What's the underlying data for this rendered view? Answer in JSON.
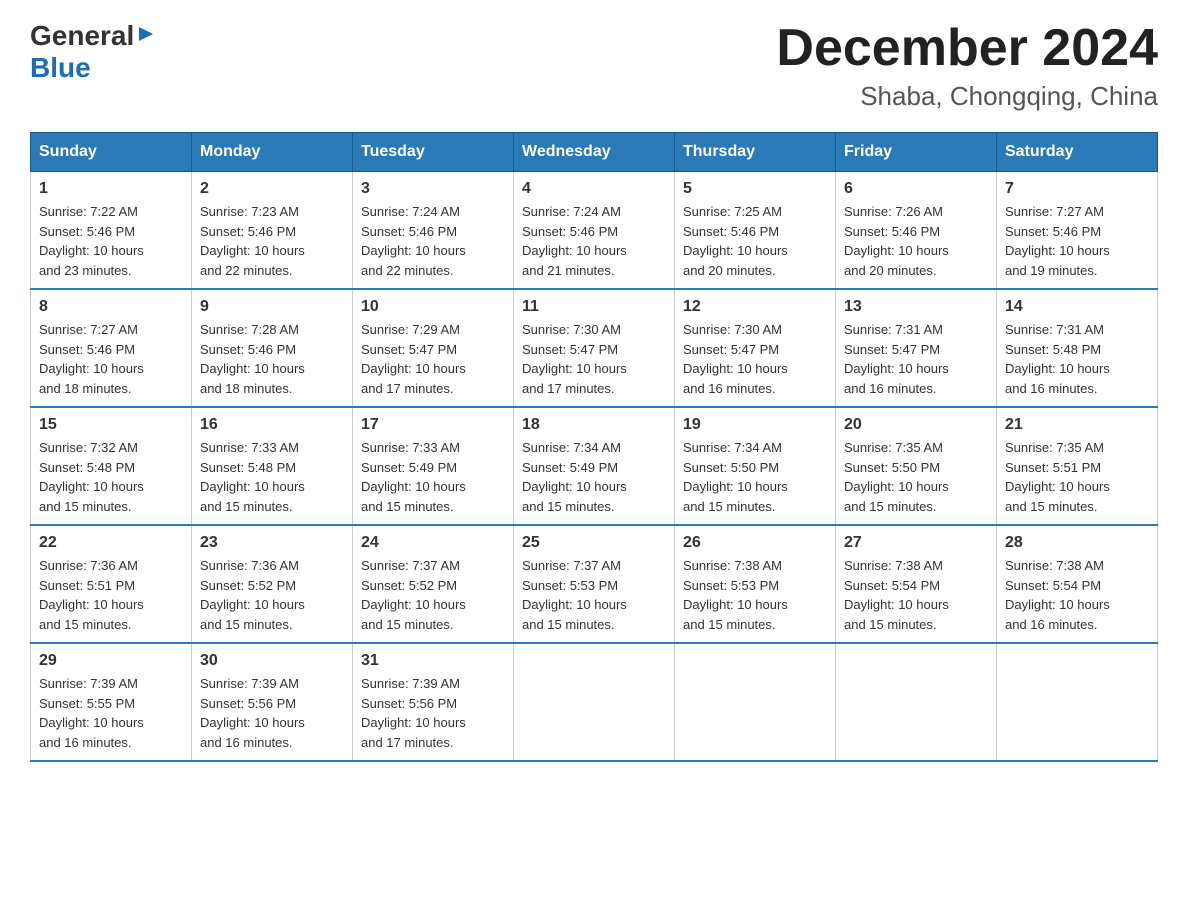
{
  "logo": {
    "general": "General",
    "blue": "Blue",
    "triangle": "▶"
  },
  "title": "December 2024",
  "subtitle": "Shaba, Chongqing, China",
  "days_of_week": [
    "Sunday",
    "Monday",
    "Tuesday",
    "Wednesday",
    "Thursday",
    "Friday",
    "Saturday"
  ],
  "weeks": [
    [
      {
        "day": "1",
        "sunrise": "7:22 AM",
        "sunset": "5:46 PM",
        "daylight": "10 hours and 23 minutes."
      },
      {
        "day": "2",
        "sunrise": "7:23 AM",
        "sunset": "5:46 PM",
        "daylight": "10 hours and 22 minutes."
      },
      {
        "day": "3",
        "sunrise": "7:24 AM",
        "sunset": "5:46 PM",
        "daylight": "10 hours and 22 minutes."
      },
      {
        "day": "4",
        "sunrise": "7:24 AM",
        "sunset": "5:46 PM",
        "daylight": "10 hours and 21 minutes."
      },
      {
        "day": "5",
        "sunrise": "7:25 AM",
        "sunset": "5:46 PM",
        "daylight": "10 hours and 20 minutes."
      },
      {
        "day": "6",
        "sunrise": "7:26 AM",
        "sunset": "5:46 PM",
        "daylight": "10 hours and 20 minutes."
      },
      {
        "day": "7",
        "sunrise": "7:27 AM",
        "sunset": "5:46 PM",
        "daylight": "10 hours and 19 minutes."
      }
    ],
    [
      {
        "day": "8",
        "sunrise": "7:27 AM",
        "sunset": "5:46 PM",
        "daylight": "10 hours and 18 minutes."
      },
      {
        "day": "9",
        "sunrise": "7:28 AM",
        "sunset": "5:46 PM",
        "daylight": "10 hours and 18 minutes."
      },
      {
        "day": "10",
        "sunrise": "7:29 AM",
        "sunset": "5:47 PM",
        "daylight": "10 hours and 17 minutes."
      },
      {
        "day": "11",
        "sunrise": "7:30 AM",
        "sunset": "5:47 PM",
        "daylight": "10 hours and 17 minutes."
      },
      {
        "day": "12",
        "sunrise": "7:30 AM",
        "sunset": "5:47 PM",
        "daylight": "10 hours and 16 minutes."
      },
      {
        "day": "13",
        "sunrise": "7:31 AM",
        "sunset": "5:47 PM",
        "daylight": "10 hours and 16 minutes."
      },
      {
        "day": "14",
        "sunrise": "7:31 AM",
        "sunset": "5:48 PM",
        "daylight": "10 hours and 16 minutes."
      }
    ],
    [
      {
        "day": "15",
        "sunrise": "7:32 AM",
        "sunset": "5:48 PM",
        "daylight": "10 hours and 15 minutes."
      },
      {
        "day": "16",
        "sunrise": "7:33 AM",
        "sunset": "5:48 PM",
        "daylight": "10 hours and 15 minutes."
      },
      {
        "day": "17",
        "sunrise": "7:33 AM",
        "sunset": "5:49 PM",
        "daylight": "10 hours and 15 minutes."
      },
      {
        "day": "18",
        "sunrise": "7:34 AM",
        "sunset": "5:49 PM",
        "daylight": "10 hours and 15 minutes."
      },
      {
        "day": "19",
        "sunrise": "7:34 AM",
        "sunset": "5:50 PM",
        "daylight": "10 hours and 15 minutes."
      },
      {
        "day": "20",
        "sunrise": "7:35 AM",
        "sunset": "5:50 PM",
        "daylight": "10 hours and 15 minutes."
      },
      {
        "day": "21",
        "sunrise": "7:35 AM",
        "sunset": "5:51 PM",
        "daylight": "10 hours and 15 minutes."
      }
    ],
    [
      {
        "day": "22",
        "sunrise": "7:36 AM",
        "sunset": "5:51 PM",
        "daylight": "10 hours and 15 minutes."
      },
      {
        "day": "23",
        "sunrise": "7:36 AM",
        "sunset": "5:52 PM",
        "daylight": "10 hours and 15 minutes."
      },
      {
        "day": "24",
        "sunrise": "7:37 AM",
        "sunset": "5:52 PM",
        "daylight": "10 hours and 15 minutes."
      },
      {
        "day": "25",
        "sunrise": "7:37 AM",
        "sunset": "5:53 PM",
        "daylight": "10 hours and 15 minutes."
      },
      {
        "day": "26",
        "sunrise": "7:38 AM",
        "sunset": "5:53 PM",
        "daylight": "10 hours and 15 minutes."
      },
      {
        "day": "27",
        "sunrise": "7:38 AM",
        "sunset": "5:54 PM",
        "daylight": "10 hours and 15 minutes."
      },
      {
        "day": "28",
        "sunrise": "7:38 AM",
        "sunset": "5:54 PM",
        "daylight": "10 hours and 16 minutes."
      }
    ],
    [
      {
        "day": "29",
        "sunrise": "7:39 AM",
        "sunset": "5:55 PM",
        "daylight": "10 hours and 16 minutes."
      },
      {
        "day": "30",
        "sunrise": "7:39 AM",
        "sunset": "5:56 PM",
        "daylight": "10 hours and 16 minutes."
      },
      {
        "day": "31",
        "sunrise": "7:39 AM",
        "sunset": "5:56 PM",
        "daylight": "10 hours and 17 minutes."
      },
      null,
      null,
      null,
      null
    ]
  ],
  "labels": {
    "sunrise": "Sunrise:",
    "sunset": "Sunset:",
    "daylight": "Daylight:"
  }
}
